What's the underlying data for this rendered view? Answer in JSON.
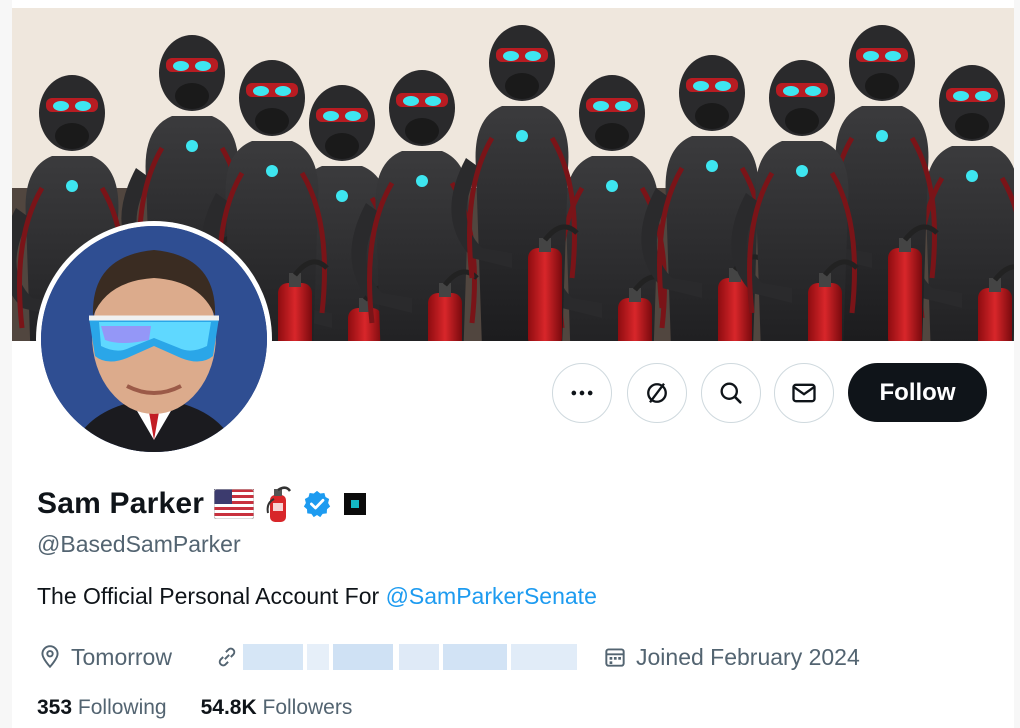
{
  "profile": {
    "display_name": "Sam Parker",
    "handle": "@BasedSamParker",
    "bio_text": "The Official Personal Account For ",
    "bio_mention": "@SamParkerSenate",
    "location": "Tomorrow",
    "joined": "Joined February 2024",
    "following_count": "353",
    "following_label": "Following",
    "followers_count": "54.8K",
    "followers_label": "Followers"
  },
  "actions": {
    "more_icon": "more-icon",
    "subscribe_icon": "grok-icon",
    "search_icon": "search-icon",
    "message_icon": "mail-icon",
    "follow_label": "Follow"
  },
  "badges": [
    "us-flag-emoji",
    "fire-extinguisher-emoji",
    "verified-badge-icon",
    "square-affiliate-badge-icon"
  ],
  "colors": {
    "accent": "#1d9bf0",
    "text_primary": "#0f1419",
    "text_secondary": "#536471",
    "follow_bg": "#0f1419",
    "border": "#cfd9de"
  }
}
